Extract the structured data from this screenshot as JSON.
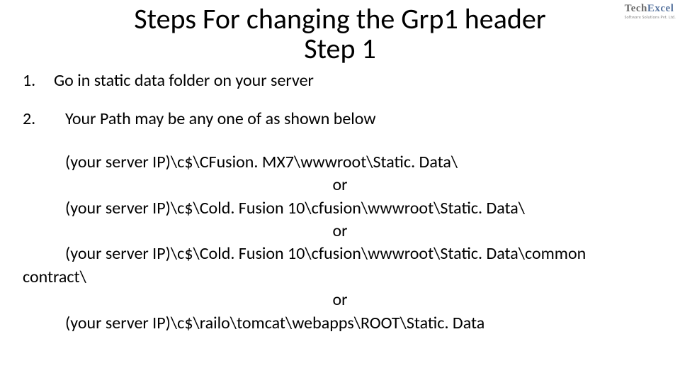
{
  "logo": {
    "brand_left": "Tech",
    "brand_right": "Excel",
    "tagline": "Software Solutions Pvt. Ltd."
  },
  "title_line1": "Steps For changing the Grp1 header",
  "title_line2": "Step 1",
  "step1_num": "1.",
  "step1_text": "Go in static data folder on your server",
  "step2_num": "2.",
  "step2_text": "Your Path may be any one of as shown below",
  "path1": "(your server IP)\\c$\\CFusion. MX7\\wwwroot\\Static. Data\\",
  "or": "or",
  "path2": "(your server IP)\\c$\\Cold. Fusion 10\\cfusion\\wwwroot\\Static. Data\\",
  "path3a": "(your server IP)\\c$\\Cold. Fusion 10\\cfusion\\wwwroot\\Static. Data\\common",
  "path3b": "contract\\",
  "path4": "(your server IP)\\c$\\railo\\tomcat\\webapps\\ROOT\\Static. Data"
}
